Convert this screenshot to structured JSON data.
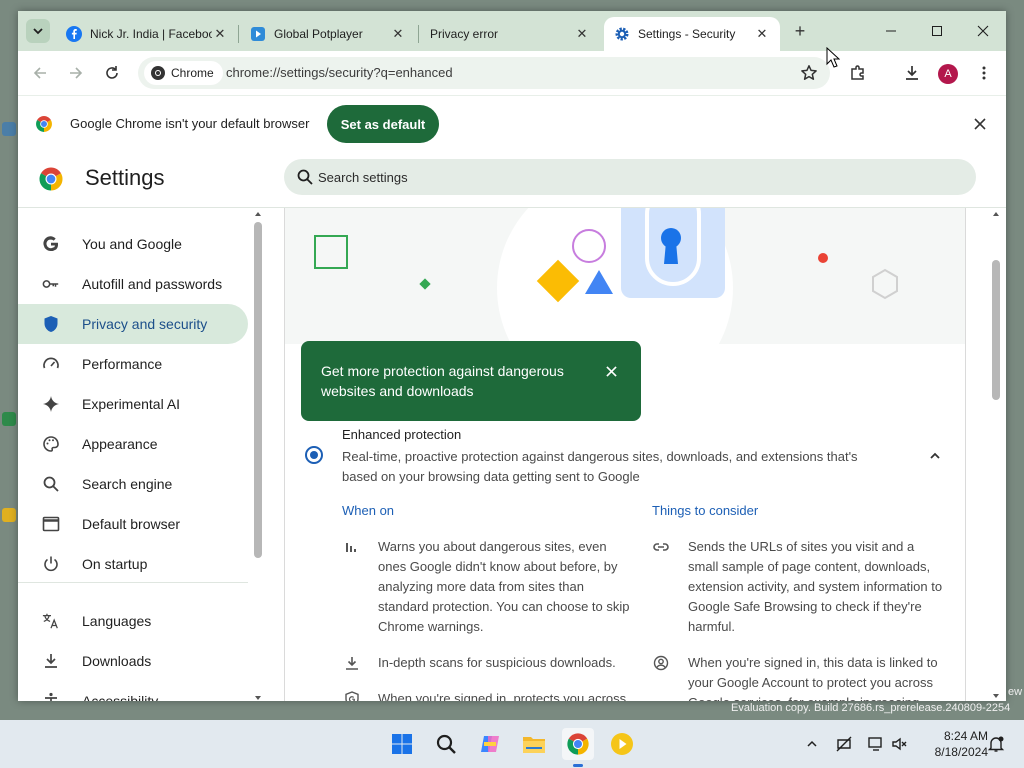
{
  "tabs": [
    {
      "label": "Nick Jr. India | Facebook",
      "icon": "facebook-icon",
      "active": false
    },
    {
      "label": "Global Potplayer",
      "icon": "play-icon",
      "active": false
    },
    {
      "label": "Privacy error",
      "icon": "",
      "active": false
    },
    {
      "label": "Settings - Security",
      "icon": "gear-icon",
      "active": true
    }
  ],
  "toolbar": {
    "site_chip": "Chrome",
    "url": "chrome://settings/security?q=enhanced",
    "avatar_letter": "A"
  },
  "infobar": {
    "message": "Google Chrome isn't your default browser",
    "button": "Set as default"
  },
  "settings": {
    "title": "Settings",
    "search_placeholder": "Search settings"
  },
  "sidebar": {
    "items": [
      {
        "label": "You and Google",
        "icon": "google-g-icon",
        "active": false
      },
      {
        "label": "Autofill and passwords",
        "icon": "key-icon",
        "active": false
      },
      {
        "label": "Privacy and security",
        "icon": "shield-icon",
        "active": true
      },
      {
        "label": "Performance",
        "icon": "speedometer-icon",
        "active": false
      },
      {
        "label": "Experimental AI",
        "icon": "sparkle-icon",
        "active": false
      },
      {
        "label": "Appearance",
        "icon": "palette-icon",
        "active": false
      },
      {
        "label": "Search engine",
        "icon": "search-icon",
        "active": false
      },
      {
        "label": "Default browser",
        "icon": "browser-window-icon",
        "active": false
      },
      {
        "label": "On startup",
        "icon": "power-icon",
        "active": false
      },
      {
        "label": "Languages",
        "icon": "translate-icon",
        "active": false
      },
      {
        "label": "Downloads",
        "icon": "download-icon",
        "active": false
      },
      {
        "label": "Accessibility",
        "icon": "accessibility-icon",
        "active": false
      }
    ]
  },
  "tooltip": {
    "text": "Get more protection against dangerous websites and downloads"
  },
  "enhanced": {
    "title": "Enhanced protection",
    "description": "Real-time, proactive protection against dangerous sites, downloads, and extensions that's based on your browsing data getting sent to Google",
    "when_on_heading": "When on",
    "consider_heading": "Things to consider",
    "when_on": [
      {
        "icon": "bar-chart-icon",
        "text": "Warns you about dangerous sites, even ones Google didn't know about before, by analyzing more data from sites than standard protection. You can choose to skip Chrome warnings."
      },
      {
        "icon": "download-icon",
        "text": "In-depth scans for suspicious downloads."
      },
      {
        "icon": "google-shield-icon",
        "text": "When you're signed in, protects you across"
      }
    ],
    "consider": [
      {
        "icon": "link-icon",
        "text": "Sends the URLs of sites you visit and a small sample of page content, downloads, extension activity, and system information to Google Safe Browsing to check if they're harmful."
      },
      {
        "icon": "account-circle-icon",
        "text": "When you're signed in, this data is linked to your Google Account to protect you across Google services, for example increasing"
      }
    ]
  },
  "taskbar": {
    "time": "8:24 AM",
    "date": "8/18/2024"
  },
  "watermark": "Evaluation copy. Build 27686.rs_prerelease.240809-2254",
  "watermark_fragment": "ew",
  "colors": {
    "accent_green": "#1e6a3a",
    "tab_strip": "#d3e3d5",
    "link_blue": "#1c5fb5",
    "nav_active": "#d8e9dc"
  }
}
